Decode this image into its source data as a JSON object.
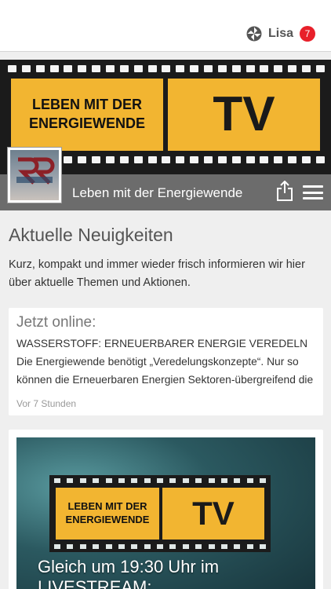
{
  "header": {
    "username": "Lisa",
    "notification_count": "7",
    "app_icon": "app-logo-icon"
  },
  "banner": {
    "line1": "LEBEN MIT DER",
    "line2": "ENERGIEWENDE",
    "tv": "TV"
  },
  "site": {
    "title": "Leben mit der Energiewende",
    "share_icon": "share-icon",
    "menu_icon": "hamburger-menu-icon"
  },
  "section": {
    "title": "Aktuelle Neuigkeiten",
    "description": "Kurz, kompakt und immer wieder frisch informieren wir hier über aktuelle Themen und Aktionen."
  },
  "news_item": {
    "heading": "Jetzt online:",
    "body": "WASSERSTOFF: ERNEUERBARER ENERGIE VEREDELN Die Energiewende benötigt „Veredelungskonzepte“. Nur so können die Erneuerbaren Energien Sektoren-übergreifend die",
    "time": "Vor 7 Stunden"
  },
  "media_item": {
    "image_line1": "LEBEN MIT DER",
    "image_line2": "ENERGIEWENDE",
    "image_tv": "TV",
    "caption_line1": "Gleich um 19:30 Uhr im",
    "caption_line2": "LIVESTREAM:"
  },
  "colors": {
    "accent_yellow": "#f2b531",
    "titlebar_gray": "#6c6c6c",
    "badge_red": "#e8202a"
  }
}
